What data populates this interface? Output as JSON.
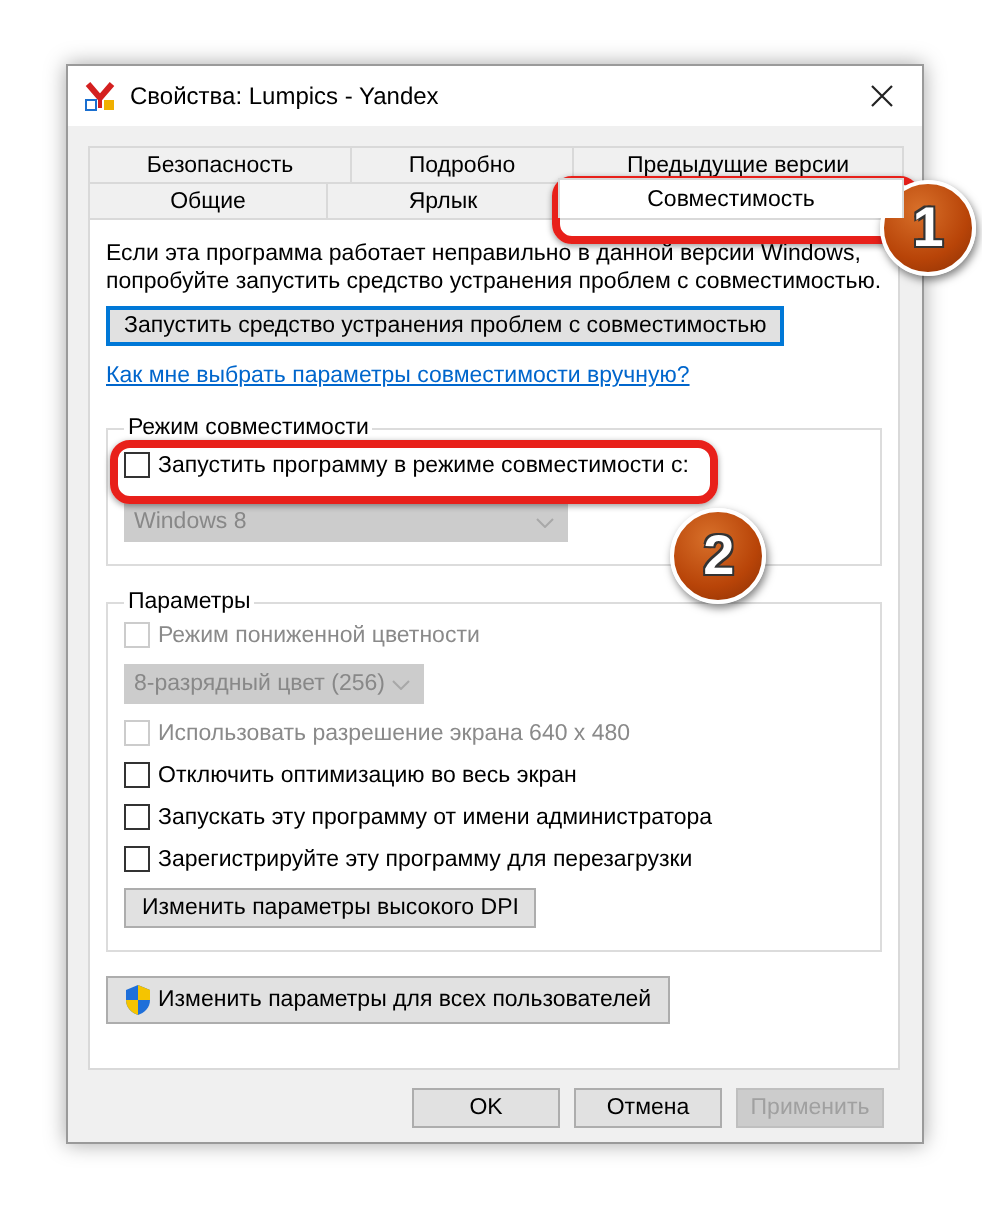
{
  "window": {
    "title": "Свойства: Lumpics - Yandex"
  },
  "tab_rows": [
    [
      {
        "label": "Безопасность",
        "selected": false
      },
      {
        "label": "Подробно",
        "selected": false
      },
      {
        "label": "Предыдущие версии",
        "selected": false
      }
    ],
    [
      {
        "label": "Общие",
        "selected": false
      },
      {
        "label": "Ярлык",
        "selected": false
      },
      {
        "label": "Совместимость",
        "selected": true
      }
    ]
  ],
  "intro": "Если эта программа работает неправильно в данной версии Windows, попробуйте запустить средство устранения проблем с совместимостью.",
  "troubleshoot_button": "Запустить средство устранения проблем с совместимостью",
  "help_link": "Как мне выбрать параметры совместимости вручную?",
  "compat_group": {
    "title": "Режим совместимости",
    "items": [
      {
        "kind": "checkbox",
        "label": "Запустить программу в режиме совместимости с:",
        "checked": false,
        "disabled": false
      },
      {
        "kind": "dropdown",
        "value": "Windows 8",
        "disabled": true
      }
    ]
  },
  "settings_group": {
    "title": "Параметры",
    "items": [
      {
        "kind": "checkbox",
        "label": "Режим пониженной цветности",
        "checked": false,
        "disabled": true
      },
      {
        "kind": "dropdown",
        "value": "8-разрядный цвет (256)",
        "disabled": true
      },
      {
        "kind": "checkbox",
        "label": "Использовать разрешение экрана 640 x 480",
        "checked": false,
        "disabled": true
      },
      {
        "kind": "checkbox",
        "label": "Отключить оптимизацию во весь экран",
        "checked": false,
        "disabled": false
      },
      {
        "kind": "checkbox",
        "label": "Запускать эту программу от имени администратора",
        "checked": false,
        "disabled": false
      },
      {
        "kind": "checkbox",
        "label": "Зарегистрируйте эту программу для перезагрузки",
        "checked": false,
        "disabled": false
      },
      {
        "kind": "button",
        "label": "Изменить параметры высокого DPI",
        "disabled": false
      }
    ]
  },
  "all_users_button": "Изменить параметры для всех пользователей",
  "buttons": [
    {
      "label": "OK",
      "disabled": false
    },
    {
      "label": "Отмена",
      "disabled": false
    },
    {
      "label": "Применить",
      "disabled": true
    }
  ],
  "callouts": [
    {
      "number": "1"
    },
    {
      "number": "2"
    }
  ]
}
